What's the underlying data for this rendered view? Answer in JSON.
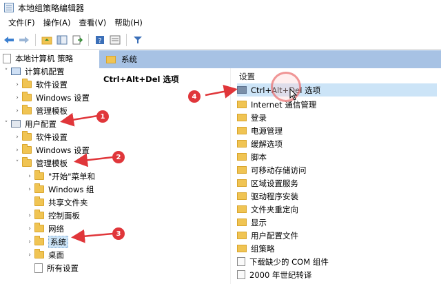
{
  "window": {
    "title": "本地组策略编辑器"
  },
  "menu": [
    {
      "label": "文件(F)"
    },
    {
      "label": "操作(A)"
    },
    {
      "label": "查看(V)"
    },
    {
      "label": "帮助(H)"
    }
  ],
  "toolbar_icons": [
    "back-arrow-icon",
    "forward-arrow-icon",
    "up-folder-icon",
    "show-hide-tree-icon",
    "export-list-icon",
    "help-icon",
    "properties-icon",
    "filter-icon"
  ],
  "tree": [
    {
      "label": "本地计算机 策略",
      "icon": "document-icon",
      "chevron": ""
    },
    {
      "label": "计算机配置",
      "icon": "computer-icon",
      "chevron": "v"
    },
    {
      "label": "软件设置",
      "icon": "folder-icon",
      "chevron": ">"
    },
    {
      "label": "Windows 设置",
      "icon": "folder-icon",
      "chevron": ">"
    },
    {
      "label": "管理模板",
      "icon": "folder-icon",
      "chevron": ">"
    },
    {
      "label": "用户配置",
      "icon": "user-icon",
      "chevron": "v"
    },
    {
      "label": "软件设置",
      "icon": "folder-icon",
      "chevron": ">"
    },
    {
      "label": "Windows 设置",
      "icon": "folder-icon",
      "chevron": ">"
    },
    {
      "label": "管理模板",
      "icon": "folder-icon",
      "chevron": "v"
    },
    {
      "label": "\"开始\"菜单和",
      "icon": "folder-icon",
      "chevron": ">"
    },
    {
      "label": "Windows 组",
      "icon": "folder-icon",
      "chevron": ">"
    },
    {
      "label": "共享文件夹",
      "icon": "folder-icon",
      "chevron": ""
    },
    {
      "label": "控制面板",
      "icon": "folder-icon",
      "chevron": ">"
    },
    {
      "label": "网络",
      "icon": "folder-icon",
      "chevron": ">"
    },
    {
      "label": "系统",
      "icon": "folder-icon",
      "chevron": ">",
      "selected": true
    },
    {
      "label": "桌面",
      "icon": "folder-icon",
      "chevron": ">"
    },
    {
      "label": "所有设置",
      "icon": "settings-icon",
      "chevron": ""
    }
  ],
  "right_header": {
    "label": "系统"
  },
  "policy_title": "Ctrl+Alt+Del 选项",
  "list_header": "设置",
  "list": [
    {
      "label": "Ctrl+Alt+Del 选项",
      "icon": "folder-icon",
      "highlight": true
    },
    {
      "label": "Internet 通信管理",
      "icon": "folder-icon"
    },
    {
      "label": "登录",
      "icon": "folder-icon"
    },
    {
      "label": "电源管理",
      "icon": "folder-icon"
    },
    {
      "label": "缓解选项",
      "icon": "folder-icon"
    },
    {
      "label": "脚本",
      "icon": "folder-icon"
    },
    {
      "label": "可移动存储访问",
      "icon": "folder-icon"
    },
    {
      "label": "区域设置服务",
      "icon": "folder-icon"
    },
    {
      "label": "驱动程序安装",
      "icon": "folder-icon"
    },
    {
      "label": "文件夹重定向",
      "icon": "folder-icon"
    },
    {
      "label": "显示",
      "icon": "folder-icon"
    },
    {
      "label": "用户配置文件",
      "icon": "folder-icon"
    },
    {
      "label": "组策略",
      "icon": "folder-icon"
    },
    {
      "label": "下载缺少的 COM 组件",
      "icon": "setting-icon"
    },
    {
      "label": "2000 年世纪转译",
      "icon": "setting-icon"
    }
  ],
  "annotations": [
    "1",
    "2",
    "3",
    "4"
  ],
  "colors": {
    "header_blue": "#a7c2e4",
    "highlight": "#cce4f7",
    "annotation_red": "#e0363a",
    "folder": "#f0c453"
  }
}
